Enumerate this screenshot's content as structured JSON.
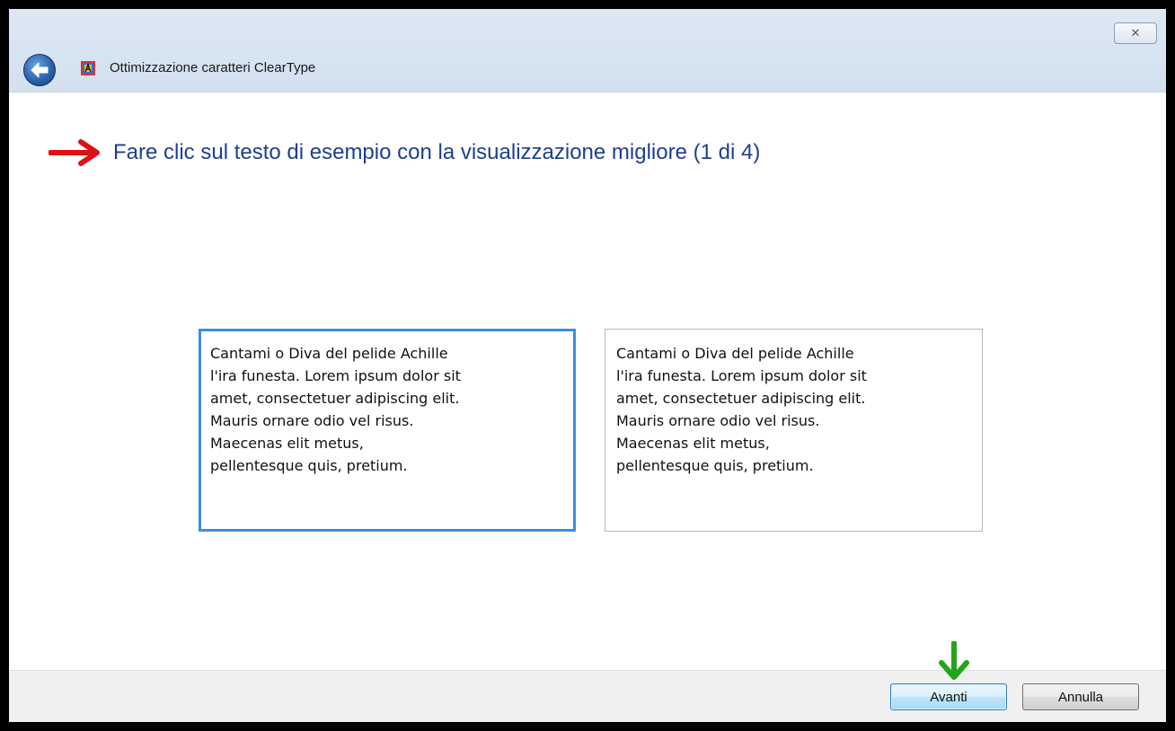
{
  "window": {
    "title": "Ottimizzazione caratteri ClearType",
    "close_symbol": "✕",
    "back_icon": "back-arrow-icon",
    "app_icon": "cleartype-icon"
  },
  "main": {
    "heading": "Fare clic sul testo di esempio con la visualizzazione migliore (1 di 4)",
    "samples": [
      {
        "text": "Cantami o Diva del pelide Achille\nl'ira funesta. Lorem ipsum dolor sit\namet, consectetuer adipiscing elit.\nMauris ornare odio vel risus.\nMaecenas elit metus,\npellentesque quis, pretium.",
        "selected": true
      },
      {
        "text": "Cantami o Diva del pelide Achille\nl'ira funesta. Lorem ipsum dolor sit\namet, consectetuer adipiscing elit.\nMauris ornare odio vel risus.\nMaecenas elit metus,\npellentesque quis, pretium.",
        "selected": false
      }
    ]
  },
  "footer": {
    "next_label": "Avanti",
    "cancel_label": "Annulla"
  },
  "annotations": {
    "heading_arrow_color": "#e01010",
    "next_arrow_color": "#22a51a"
  },
  "colors": {
    "heading": "#1e3f8f",
    "selected_border": "#3a8ee6"
  }
}
